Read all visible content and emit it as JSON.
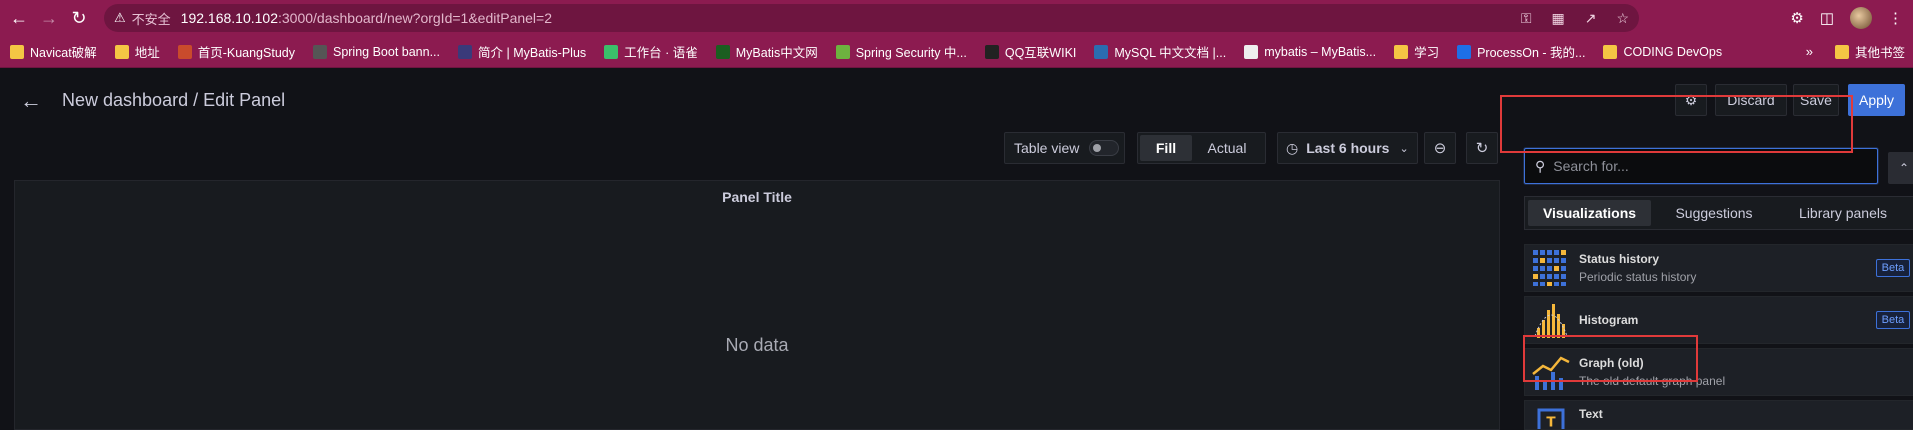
{
  "browser": {
    "insecure_label": "不安全",
    "url_host": "192.168.10.102",
    "url_rest": ":3000/dashboard/new?orgId=1&editPanel=2",
    "bookmarks": [
      {
        "label": "Navicat破解",
        "color": "#f4c644"
      },
      {
        "label": "地址",
        "color": "#f4c644"
      },
      {
        "label": "首页-KuangStudy",
        "color": "#c94b2c"
      },
      {
        "label": "Spring Boot bann...",
        "color": "#555555"
      },
      {
        "label": "简介 | MyBatis-Plus",
        "color": "#3a3a7a"
      },
      {
        "label": "工作台 · 语雀",
        "color": "#3bbf6a"
      },
      {
        "label": "MyBatis中文网",
        "color": "#1b5e20"
      },
      {
        "label": "Spring Security 中...",
        "color": "#6db33f"
      },
      {
        "label": "QQ互联WIKI",
        "color": "#222222"
      },
      {
        "label": "MySQL 中文文档 |...",
        "color": "#2a6db0"
      },
      {
        "label": "mybatis – MyBatis...",
        "color": "#eeeeee"
      },
      {
        "label": "学习",
        "color": "#f4c644"
      },
      {
        "label": "ProcessOn - 我的...",
        "color": "#1e6fe6"
      },
      {
        "label": "CODING DevOps",
        "color": "#f4c644"
      }
    ],
    "more_label": "»",
    "other_bookmarks": "其他书签"
  },
  "header": {
    "title": "New dashboard / Edit Panel",
    "discard": "Discard",
    "save": "Save",
    "apply": "Apply"
  },
  "toolbar": {
    "table_view": "Table view",
    "fill": "Fill",
    "actual": "Actual",
    "time_range": "Last 6 hours"
  },
  "panel": {
    "title": "Panel Title",
    "empty": "No data"
  },
  "viz_picker": {
    "search_placeholder": "Search for...",
    "tabs": [
      "Visualizations",
      "Suggestions",
      "Library panels"
    ],
    "items": [
      {
        "name": "Status history",
        "desc": "Periodic status history",
        "badge": "Beta"
      },
      {
        "name": "Histogram",
        "desc": "",
        "badge": "Beta"
      },
      {
        "name": "Graph (old)",
        "desc": "The old default graph panel",
        "badge": ""
      },
      {
        "name": "Text",
        "desc": "",
        "badge": ""
      }
    ]
  },
  "colors": {
    "chrome": "#8c1b50",
    "accent": "#3d71d9",
    "highlight": "#e03a3a"
  }
}
